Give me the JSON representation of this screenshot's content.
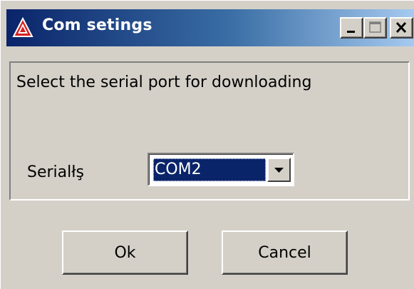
{
  "window": {
    "title": "Com setings",
    "icon": "app-triangle-icon",
    "controls": [
      "minimize-icon",
      "maximize-icon",
      "close-icon"
    ]
  },
  "dialog": {
    "prompt": "Select the serial port for downloading",
    "serial_label": "Serialłş",
    "port_select": {
      "value": "COM2"
    }
  },
  "buttons": {
    "ok": "Ok",
    "cancel": "Cancel"
  },
  "colors": {
    "titlebar_start": "#0a246a",
    "titlebar_end": "#a6caf0",
    "face": "#d4d0c8",
    "selection": "#0a246a",
    "icon_red": "#d42020"
  }
}
